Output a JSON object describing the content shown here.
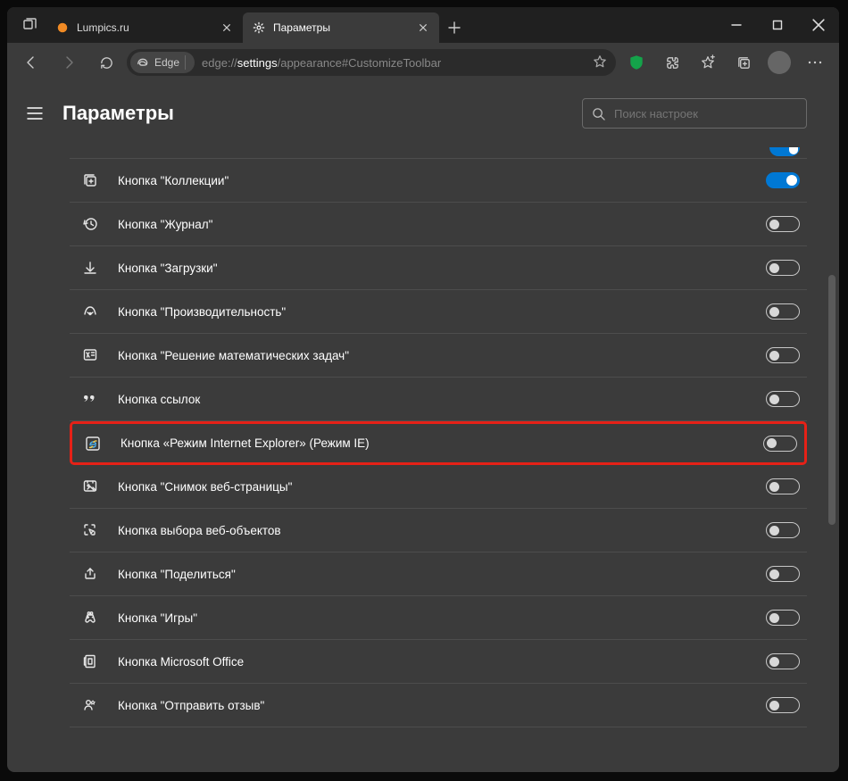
{
  "tabs": [
    {
      "title": "Lumpics.ru",
      "favicon": "orange-dot",
      "active": false
    },
    {
      "title": "Параметры",
      "favicon": "gear",
      "active": true
    }
  ],
  "window_controls": {
    "minimize": "—",
    "maximize": "▢",
    "close": "✕"
  },
  "toolbar": {
    "addr_badge_label": "Edge",
    "url_dim_prefix": "edge://",
    "url_hl": "settings",
    "url_dim_suffix": "/appearance#CustomizeToolbar"
  },
  "page": {
    "title": "Параметры",
    "search_placeholder": "Поиск настроек"
  },
  "settings": [
    {
      "id": "collections",
      "icon": "collections",
      "label": "Кнопка \"Коллекции\"",
      "on": true,
      "highlighted": false
    },
    {
      "id": "history",
      "icon": "history",
      "label": "Кнопка \"Журнал\"",
      "on": false,
      "highlighted": false
    },
    {
      "id": "downloads",
      "icon": "download",
      "label": "Кнопка \"Загрузки\"",
      "on": false,
      "highlighted": false
    },
    {
      "id": "performance",
      "icon": "performance",
      "label": "Кнопка \"Производительность\"",
      "on": false,
      "highlighted": false
    },
    {
      "id": "math",
      "icon": "math",
      "label": "Кнопка \"Решение математических задач\"",
      "on": false,
      "highlighted": false
    },
    {
      "id": "citations",
      "icon": "quote",
      "label": "Кнопка ссылок",
      "on": false,
      "highlighted": false
    },
    {
      "id": "iemode",
      "icon": "ie",
      "label": "Кнопка «Режим Internet Explorer» (Режим IE)",
      "on": false,
      "highlighted": true
    },
    {
      "id": "capture",
      "icon": "capture",
      "label": "Кнопка \"Снимок веб-страницы\"",
      "on": false,
      "highlighted": false
    },
    {
      "id": "webselect",
      "icon": "webselect",
      "label": "Кнопка выбора веб-объектов",
      "on": false,
      "highlighted": false
    },
    {
      "id": "share",
      "icon": "share",
      "label": "Кнопка \"Поделиться\"",
      "on": false,
      "highlighted": false
    },
    {
      "id": "games",
      "icon": "games",
      "label": "Кнопка \"Игры\"",
      "on": false,
      "highlighted": false
    },
    {
      "id": "office",
      "icon": "office",
      "label": "Кнопка Microsoft Office",
      "on": false,
      "highlighted": false
    },
    {
      "id": "feedback",
      "icon": "feedback",
      "label": "Кнопка \"Отправить отзыв\"",
      "on": false,
      "highlighted": false
    }
  ]
}
